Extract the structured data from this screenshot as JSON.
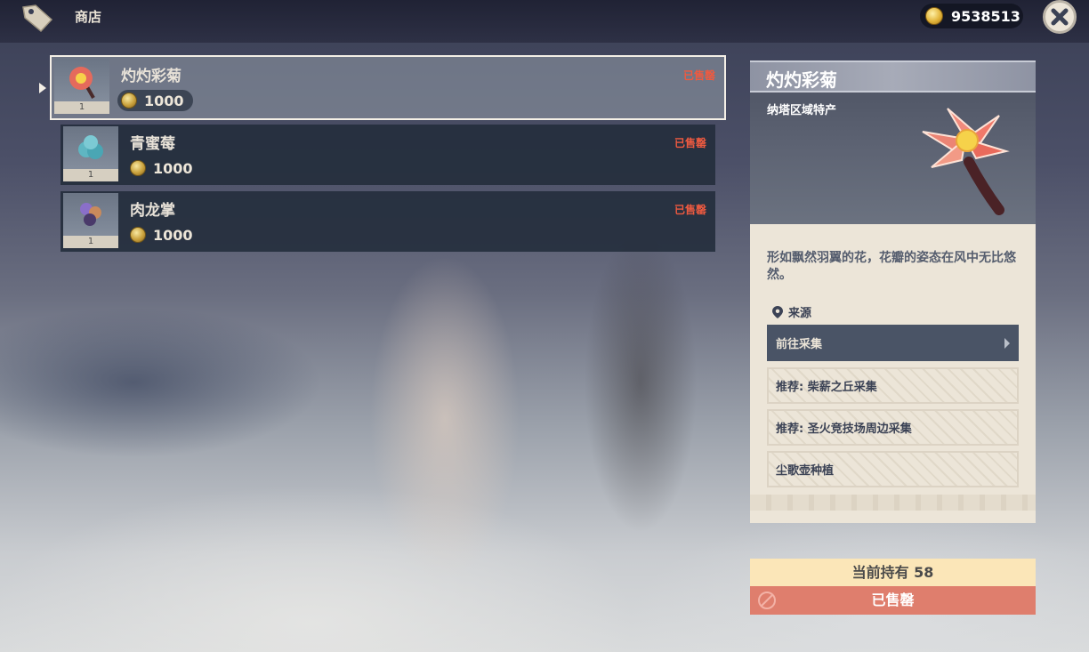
{
  "header": {
    "title": "商店",
    "currency_value": "9538513"
  },
  "items": [
    {
      "name": "灼灼彩菊",
      "price": "1000",
      "quantity": "1",
      "status": "已售罄",
      "selected": true
    },
    {
      "name": "青蜜莓",
      "price": "1000",
      "quantity": "1",
      "status": "已售罄",
      "selected": false
    },
    {
      "name": "肉龙掌",
      "price": "1000",
      "quantity": "1",
      "status": "已售罄",
      "selected": false
    }
  ],
  "detail": {
    "title": "灼灼彩菊",
    "region": "纳塔区域特产",
    "description": "形如飘然羽翼的花，花瓣的姿态在风中无比悠然。",
    "source_label": "来源",
    "sources": [
      {
        "label": "前往采集",
        "primary": true
      },
      {
        "label": "推荐: 柴薪之丘采集",
        "primary": false
      },
      {
        "label": "推荐: 圣火竞技场周边采集",
        "primary": false
      },
      {
        "label": "尘歌壶种植",
        "primary": false
      }
    ]
  },
  "footer": {
    "owned_text": "当前持有 58",
    "soldout_text": "已售罄"
  },
  "icons": {
    "shop": "price-tag-icon",
    "currency": "mora-coin-icon",
    "close": "close-icon",
    "location": "location-pin-icon",
    "disabled": "prohibited-icon"
  },
  "colors": {
    "soldout_red": "#ee5a40",
    "owned_bg": "#fbe6b8",
    "soldout_bg": "#df7e6d",
    "panel_bg": "#ece5d8"
  }
}
